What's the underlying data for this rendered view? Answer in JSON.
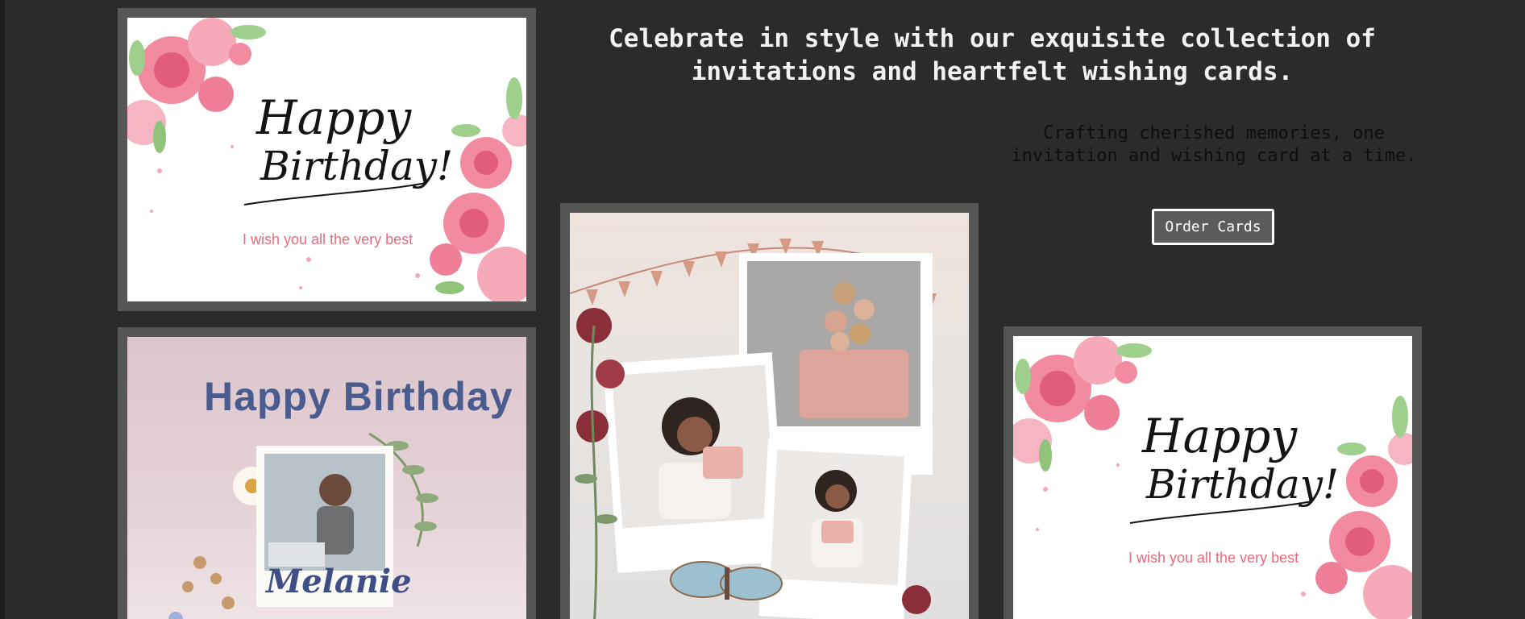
{
  "hero": {
    "headline_line1": "Celebrate in style with our exquisite collection of",
    "headline_line2": "invitations and heartfelt wishing cards.",
    "subline_line1": "Crafting cherished memories, one",
    "subline_line2": "invitation and wishing card at a time.",
    "order_button": "Order Cards"
  },
  "cards": {
    "floral_1": {
      "script_line1": "Happy",
      "script_line2": "Birthday!",
      "wish": "I wish you all the very best"
    },
    "floral_2": {
      "script_line1": "Happy",
      "script_line2": "Birthday!",
      "wish": "I wish you all the very best"
    },
    "photo_card": {
      "title": "Happy Birthday",
      "name": "Melanie"
    }
  },
  "colors": {
    "background": "#2b2b2b",
    "frame": "#565656",
    "accent_pink": "#e86a7e",
    "title_blue": "#4a5c8e"
  }
}
